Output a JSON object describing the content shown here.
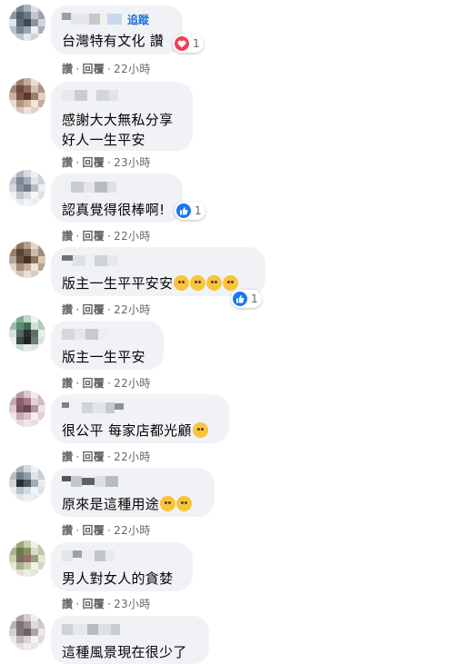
{
  "comments": [
    {
      "name_suffix": "追蹤",
      "text": "台灣特有文化 讚",
      "reaction_count": "1",
      "reaction_type": "love",
      "time": "22小時"
    },
    {
      "text": "感謝大大無私分享\n好人一生平安",
      "time": "23小時"
    },
    {
      "text": "認真覺得很棒啊!",
      "reaction_count": "1",
      "reaction_type": "like",
      "time": "22小時"
    },
    {
      "text": "版主一生平平安安",
      "reaction_count": "1",
      "reaction_type": "like",
      "time": "22小時"
    },
    {
      "text": "版主一生平安",
      "time": "22小時"
    },
    {
      "text": "很公平 每家店都光顧",
      "time": "22小時"
    },
    {
      "text": "原來是這種用途",
      "time": "22小時"
    },
    {
      "text": "男人對女人的貪婪",
      "time": "23小時"
    },
    {
      "text": "這種風景現在很少了",
      "time": ""
    }
  ],
  "actions": {
    "like": "讚",
    "reply": "回覆",
    "separator": "·"
  },
  "icons": {
    "love": "heart-icon",
    "like": "thumbs-up-icon",
    "emoji": "smiley-emoji"
  },
  "colors": {
    "bubble": "#f0f2f5",
    "meta": "#65676b",
    "link": "#216fdb",
    "love": "#f33e58",
    "like": "#1877f2"
  }
}
